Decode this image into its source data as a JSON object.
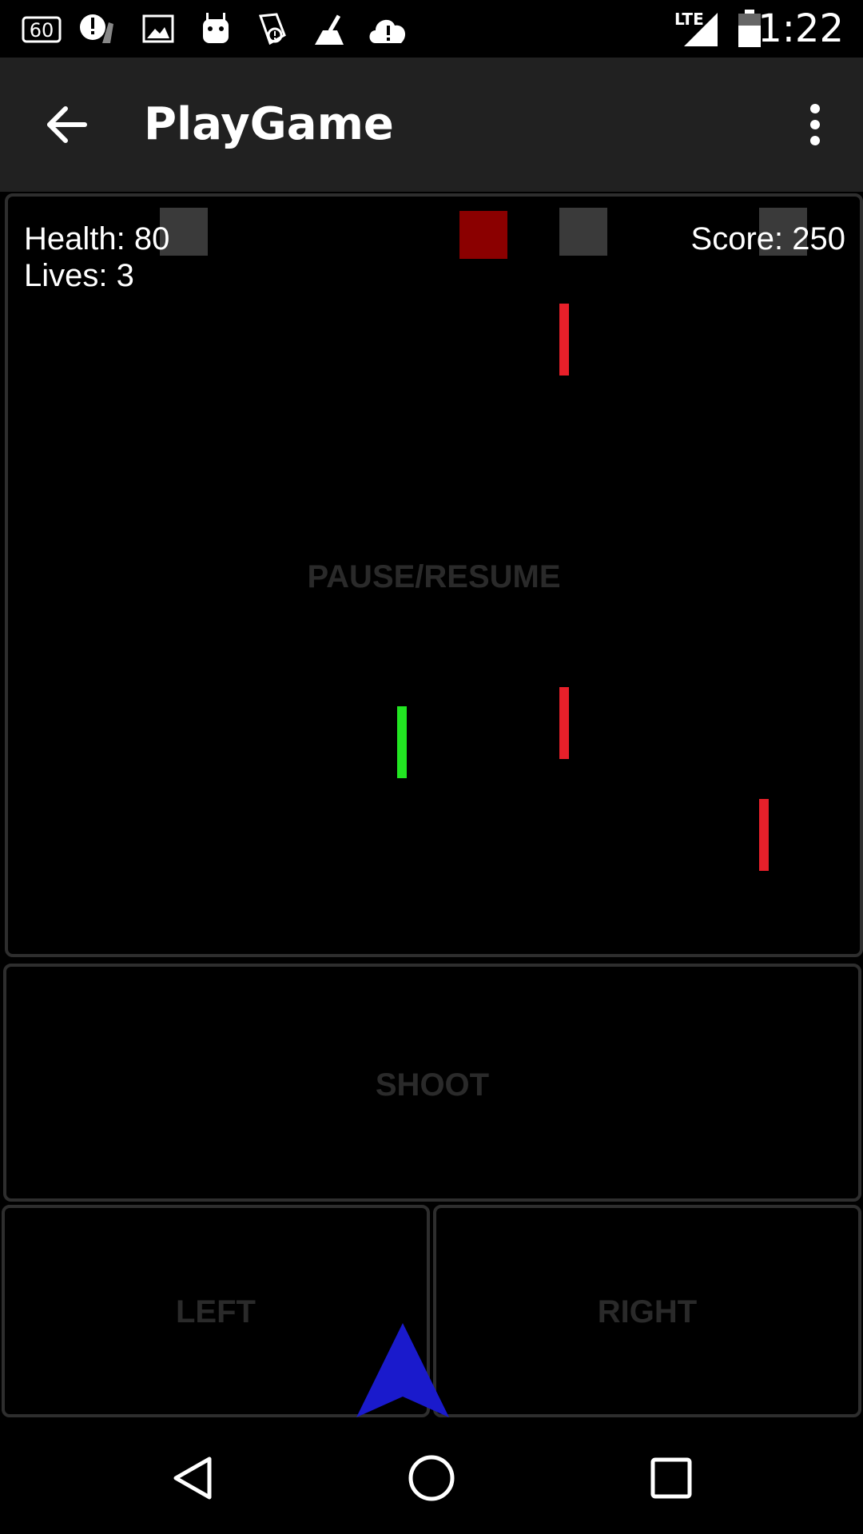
{
  "status_bar": {
    "time": "1:22",
    "network_label": "LTE",
    "left_icons": [
      "sixty-icon",
      "alert-broom-icon",
      "image-icon",
      "android-icon",
      "alert-can-icon",
      "broom-icon",
      "cloud-alert-icon"
    ]
  },
  "app_bar": {
    "title": "PlayGame",
    "back_icon": "arrow-back-icon",
    "menu_icon": "more-vert-icon"
  },
  "hud": {
    "health": "Health: 80",
    "lives": "Lives: 3",
    "score": "Score: 250"
  },
  "controls": {
    "pause_resume": "PAUSE/RESUME",
    "shoot": "SHOOT",
    "left": "LEFT",
    "right": "RIGHT"
  },
  "colors": {
    "enemy_gray": "#3a3a3a",
    "enemy_red": "#8b0000",
    "enemy_laser": "#e8202a",
    "player_laser": "#22e622",
    "player_ship": "#1a1acc"
  },
  "nav_bar": {
    "back_icon": "nav-back-icon",
    "home_icon": "nav-home-icon",
    "recents_icon": "nav-recents-icon"
  }
}
